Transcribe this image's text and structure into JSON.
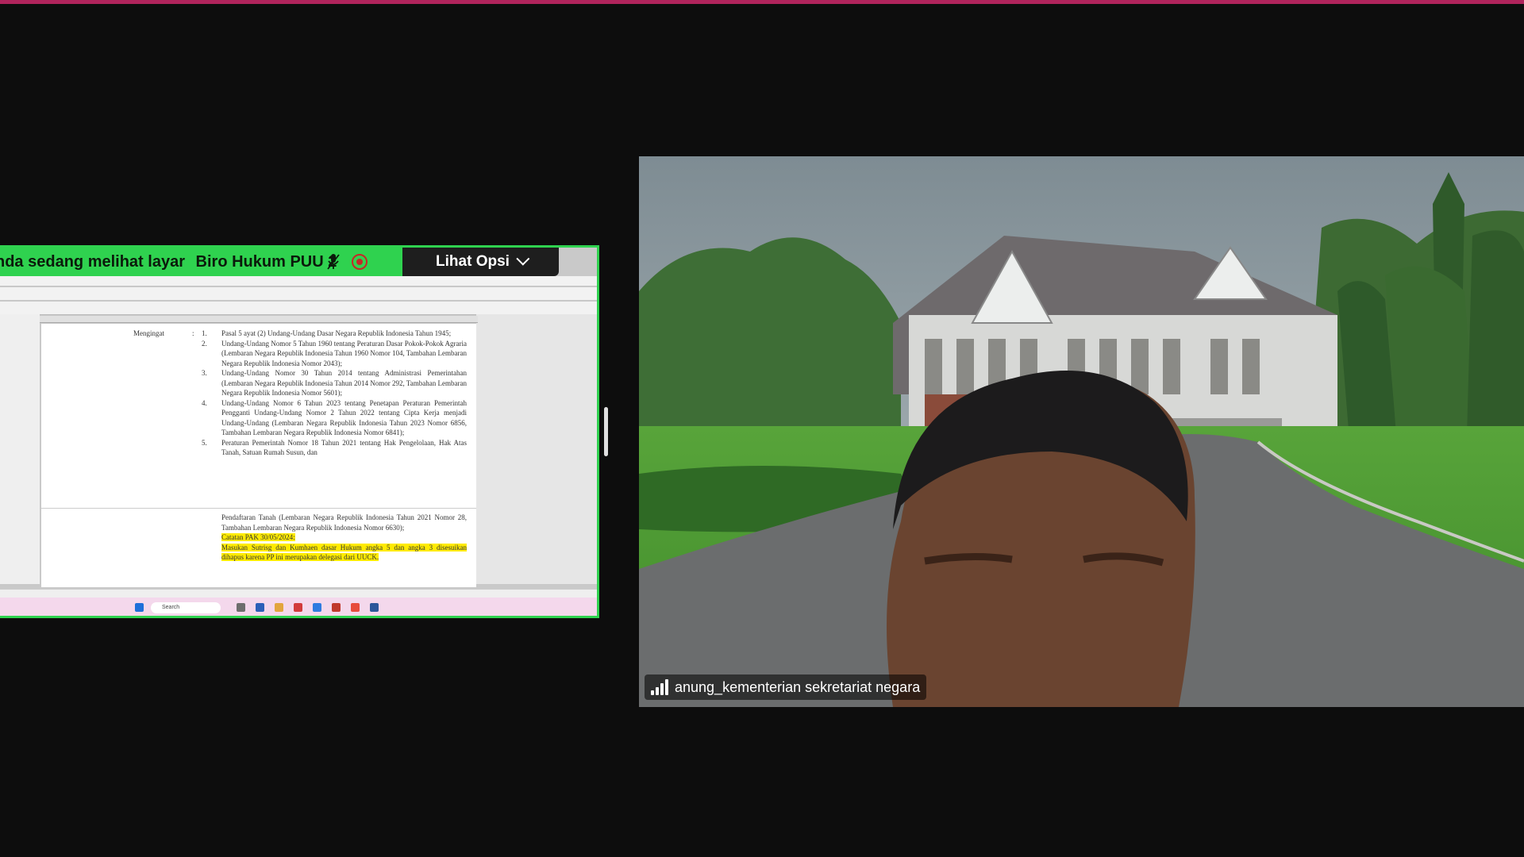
{
  "share": {
    "banner_text": "nda sedang melihat layar",
    "presenter": "Biro Hukum PUU 2",
    "options_label": "Lihat Opsi",
    "doc": {
      "label": "Mengingat",
      "colon": ":",
      "items": [
        {
          "num": "1.",
          "text": "Pasal 5 ayat (2) Undang-Undang Dasar Negara Republik Indonesia Tahun 1945;"
        },
        {
          "num": "2.",
          "text": "Undang-Undang Nomor 5 Tahun 1960 tentang Peraturan Dasar Pokok-Pokok Agraria (Lembaran Negara Republik Indonesia Tahun 1960 Nomor 104, Tambahan Lembaran Negara Republik Indonesia Nomor 2043);"
        },
        {
          "num": "3.",
          "text": "Undang-Undang Nomor 30 Tahun 2014 tentang Administrasi Pemerintahan (Lembaran Negara Republik Indonesia Tahun 2014 Nomor 292, Tambahan Lembaran Negara Republik Indonesia Nomor 5601);"
        },
        {
          "num": "4.",
          "text": "Undang-Undang Nomor 6 Tahun 2023 tentang Penetapan Peraturan Pemerintah Pengganti Undang-Undang Nomor 2 Tahun 2022 tentang Cipta Kerja menjadi Undang-Undang (Lembaran Negara Republik Indonesia Tahun 2023 Nomor 6856, Tambahan Lembaran Negara Republik Indonesia Nomor 6841);"
        },
        {
          "num": "5.",
          "text": "Peraturan Pemerintah Nomor 18 Tahun 2021 tentang Hak Pengelolaan, Hak Atas Tanah, Satuan Rumah Susun, dan"
        }
      ],
      "page2_text": "Pendaftaran Tanah (Lembaran Negara Republik Indonesia Tahun 2021 Nomor 28, Tambahan Lembaran Negara Republik Indonesia Nomor 6630);",
      "note_title": "Catatan PAK 30/05/2024:",
      "note_body": "Masukan Sutrisg dan Kumhaen dasar Hukum angka 5 dan angka 3 disesuikan dihapus karena PP ini merupakan delegasi dari UUCK."
    },
    "taskbar_search": "Search"
  },
  "participant": {
    "name": "anung_kementerian sekretariat negara"
  }
}
